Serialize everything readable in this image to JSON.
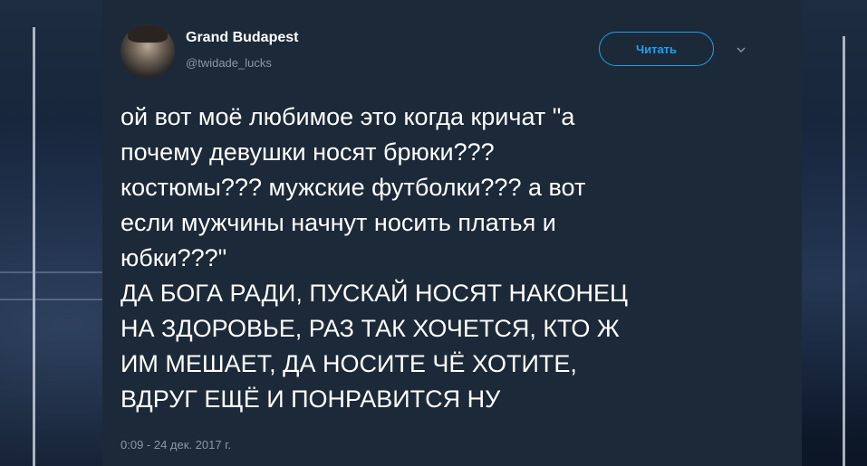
{
  "tweet": {
    "author": {
      "display_name": "Grand Budapest",
      "handle": "@twidade_lucks"
    },
    "follow_label": "Читать",
    "text_lines": [
      "ой вот моё любимое это когда кричат \"а",
      "почему девушки носят брюки???",
      "костюмы??? мужские футболки??? а вот",
      "если мужчины начнут носить платья и",
      "юбки???\"",
      "ДА БОГА РАДИ, ПУСКАЙ НОСЯТ НАКОНЕЦ",
      "НА ЗДОРОВЬЕ, РАЗ ТАК ХОЧЕТСЯ, КТО Ж",
      "ИМ МЕШАЕТ, ДА НОСИТЕ ЧЁ ХОТИТЕ,",
      "ВДРУГ ЕЩЁ И ПОНРАВИТСЯ НУ"
    ],
    "timestamp": "0:09 - 24 дек. 2017 г."
  },
  "icons": {
    "caret": "chevron-down-icon"
  },
  "colors": {
    "card_background": "#1c2938",
    "accent": "#1da1f2",
    "secondary_text": "#8899a6",
    "primary_text": "#ffffff"
  }
}
